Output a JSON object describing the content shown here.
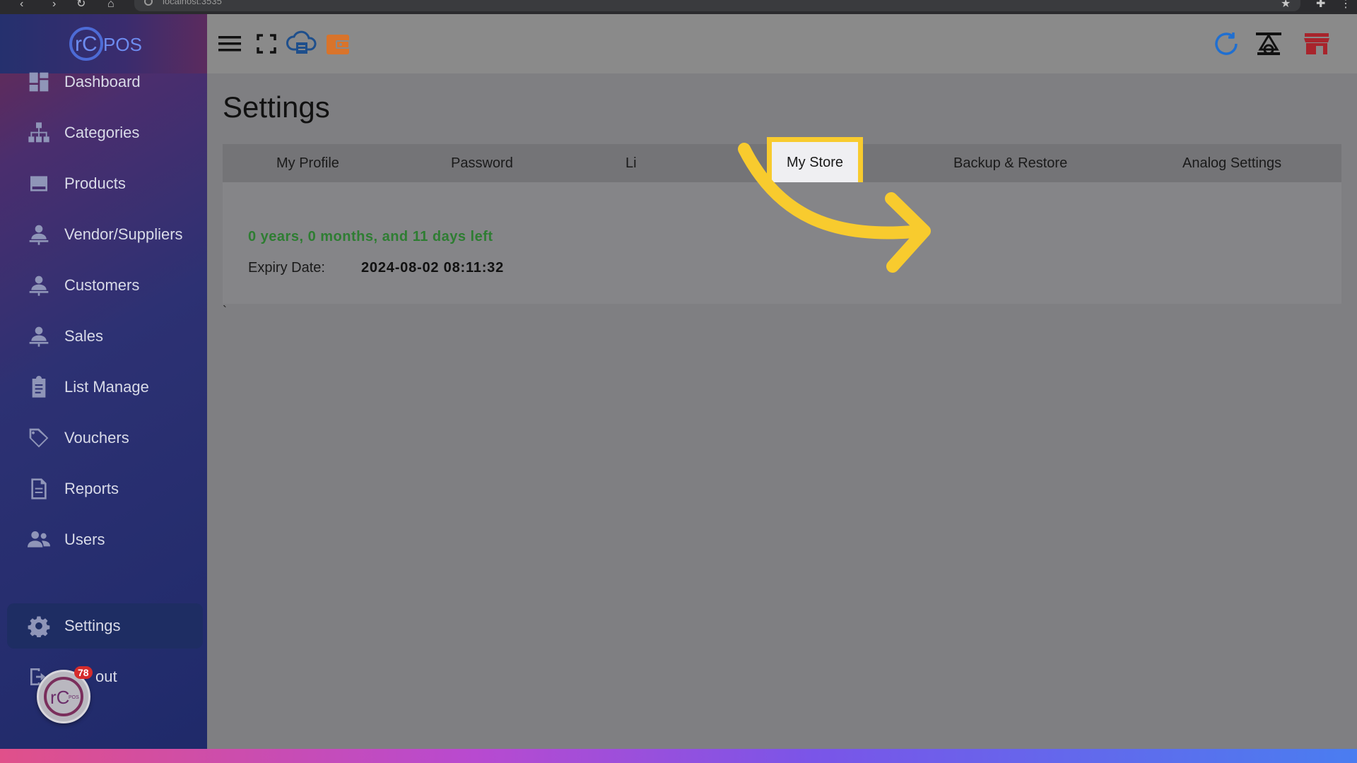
{
  "browser": {
    "url": "localhost:3535"
  },
  "app": {
    "brand_left": "rC",
    "brand_right": "POS"
  },
  "sidebar": {
    "items": [
      {
        "label": "Dashboard",
        "icon": "dashboard-icon"
      },
      {
        "label": "Categories",
        "icon": "sitemap-icon"
      },
      {
        "label": "Products",
        "icon": "box-icon"
      },
      {
        "label": "Vendor/Suppliers",
        "icon": "person-icon"
      },
      {
        "label": "Customers",
        "icon": "person-icon"
      },
      {
        "label": "Sales",
        "icon": "person-icon"
      },
      {
        "label": "List Manage",
        "icon": "clipboard-icon"
      },
      {
        "label": "Vouchers",
        "icon": "tag-icon"
      },
      {
        "label": "Reports",
        "icon": "document-icon"
      },
      {
        "label": "Users",
        "icon": "users-icon"
      },
      {
        "label": "Settings",
        "icon": "gear-icon"
      },
      {
        "label": "out",
        "icon": "logout-icon"
      }
    ],
    "notification_count": "78",
    "badge_text": "POS"
  },
  "page": {
    "title": "Settings",
    "tabs": [
      {
        "label": "My Profile"
      },
      {
        "label": "Password"
      },
      {
        "label": "Li"
      },
      {
        "label": "My Store"
      },
      {
        "label": "Backup & Restore"
      },
      {
        "label": "Analog Settings"
      }
    ],
    "active_tab": "My Store",
    "license": {
      "remaining": "0 years, 0 months, and 11 days left",
      "expiry_label": "Expiry Date:",
      "expiry_value": "2024-08-02 08:11:32"
    },
    "stray_mark": "`"
  },
  "colors": {
    "highlight": "#f8cb2e",
    "remaining_text": "#2e7d32",
    "sidebar_active": "#1e2d63"
  }
}
